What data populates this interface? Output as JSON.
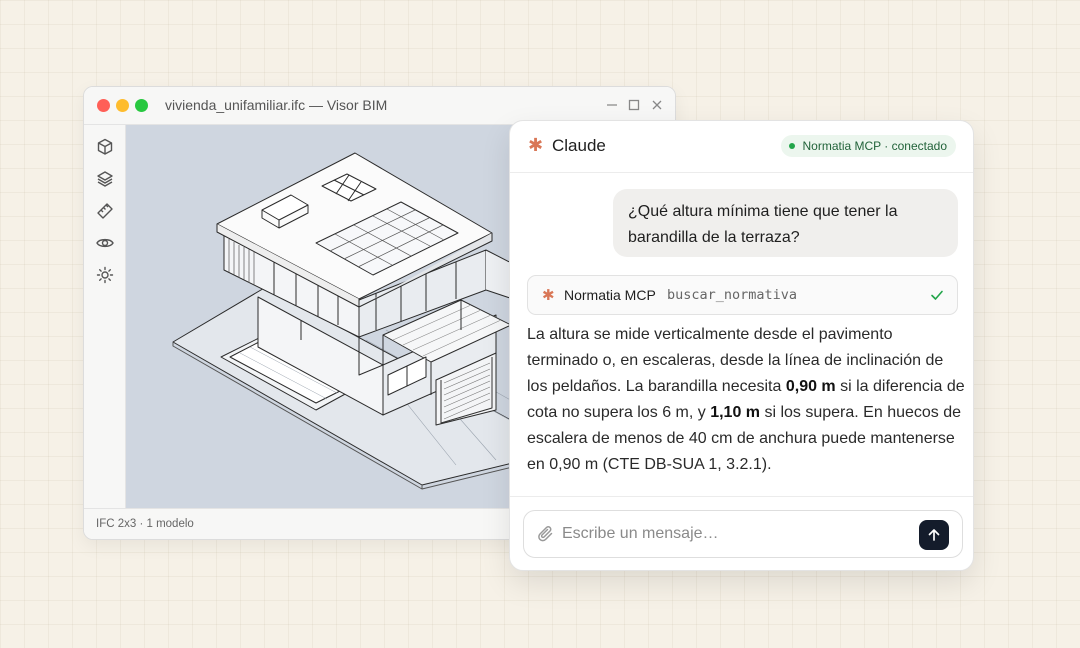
{
  "viewer": {
    "title": "vivienda_unifamiliar.ifc — Visor BIM",
    "status": "IFC 2x3 · 1 modelo",
    "tools": [
      "cube-icon",
      "layers-icon",
      "ruler-icon",
      "eye-icon",
      "sun-icon"
    ]
  },
  "chat": {
    "title": "Claude",
    "badge": "Normatia MCP · conectado",
    "user_message": "¿Qué altura mínima tiene que tener la barandilla de la terraza?",
    "tool_call": {
      "server": "Normatia MCP",
      "function": "buscar_normativa"
    },
    "answer": {
      "p1": "La altura se mide verticalmente desde el pavimento terminado o, en escaleras, desde la línea de inclinación de los peldaños. La barandilla necesita ",
      "b1": "0,90 m",
      "p2": " si la diferencia de cota no supera los 6 m, y ",
      "b2": "1,10 m",
      "p3": " si los supera. En huecos de escalera de menos de 40 cm de anchura puede mantenerse en 0,90 m (CTE DB-SUA 1, 3.2.1)."
    },
    "input_placeholder": "Escribe un mensaje…"
  },
  "colors": {
    "accent": "#d97757",
    "connected": "#22a54a",
    "send_button": "#141c2b",
    "canvas": "#cfd6e0"
  }
}
